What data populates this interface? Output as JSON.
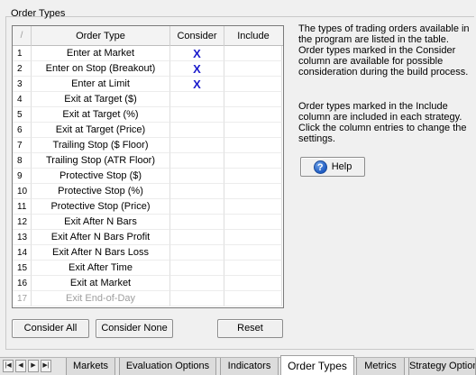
{
  "group": {
    "title": "Order Types"
  },
  "table": {
    "corner": "/",
    "columns": [
      "Order Type",
      "Consider",
      "Include"
    ],
    "rows": [
      {
        "num": "1",
        "name": "Enter at Market",
        "consider": "X",
        "include": "",
        "disabled": false
      },
      {
        "num": "2",
        "name": "Enter on Stop (Breakout)",
        "consider": "X",
        "include": "",
        "disabled": false
      },
      {
        "num": "3",
        "name": "Enter at Limit",
        "consider": "X",
        "include": "",
        "disabled": false
      },
      {
        "num": "4",
        "name": "Exit at Target ($)",
        "consider": "",
        "include": "",
        "disabled": false
      },
      {
        "num": "5",
        "name": "Exit at Target (%)",
        "consider": "",
        "include": "",
        "disabled": false
      },
      {
        "num": "6",
        "name": "Exit at Target (Price)",
        "consider": "",
        "include": "",
        "disabled": false
      },
      {
        "num": "7",
        "name": "Trailing Stop ($ Floor)",
        "consider": "",
        "include": "",
        "disabled": false
      },
      {
        "num": "8",
        "name": "Trailing Stop (ATR Floor)",
        "consider": "",
        "include": "",
        "disabled": false
      },
      {
        "num": "9",
        "name": "Protective Stop ($)",
        "consider": "",
        "include": "",
        "disabled": false
      },
      {
        "num": "10",
        "name": "Protective Stop (%)",
        "consider": "",
        "include": "",
        "disabled": false
      },
      {
        "num": "11",
        "name": "Protective Stop (Price)",
        "consider": "",
        "include": "",
        "disabled": false
      },
      {
        "num": "12",
        "name": "Exit After N Bars",
        "consider": "",
        "include": "",
        "disabled": false
      },
      {
        "num": "13",
        "name": "Exit After N Bars Profit",
        "consider": "",
        "include": "",
        "disabled": false
      },
      {
        "num": "14",
        "name": "Exit After N Bars Loss",
        "consider": "",
        "include": "",
        "disabled": false
      },
      {
        "num": "15",
        "name": "Exit After Time",
        "consider": "",
        "include": "",
        "disabled": false
      },
      {
        "num": "16",
        "name": "Exit at Market",
        "consider": "",
        "include": "",
        "disabled": false
      },
      {
        "num": "17",
        "name": "Exit End-of-Day",
        "consider": "",
        "include": "",
        "disabled": true
      }
    ]
  },
  "buttons": {
    "consider_all": "Consider All",
    "consider_none": "Consider None",
    "reset": "Reset",
    "help": "Help"
  },
  "description": {
    "para1": "The types of trading orders available in the program are listed in the table. Order types marked in the Consider column are available for possible consideration during the build process.",
    "para2": "Order types marked in the Include column are included in each strategy. Click the column entries to change the settings."
  },
  "tabs": [
    {
      "label": "Markets",
      "active": false
    },
    {
      "label": "Evaluation Options",
      "active": false
    },
    {
      "label": "Indicators",
      "active": false
    },
    {
      "label": "Order Types",
      "active": true
    },
    {
      "label": "Metrics",
      "active": false
    },
    {
      "label": "Strategy Options",
      "active": false
    }
  ],
  "nav_icons": [
    "first-tab-icon",
    "prev-tab-icon",
    "next-tab-icon",
    "last-tab-icon"
  ],
  "colors": {
    "x_mark": "#1c1ccc",
    "disabled_text": "#9e9e9e"
  }
}
